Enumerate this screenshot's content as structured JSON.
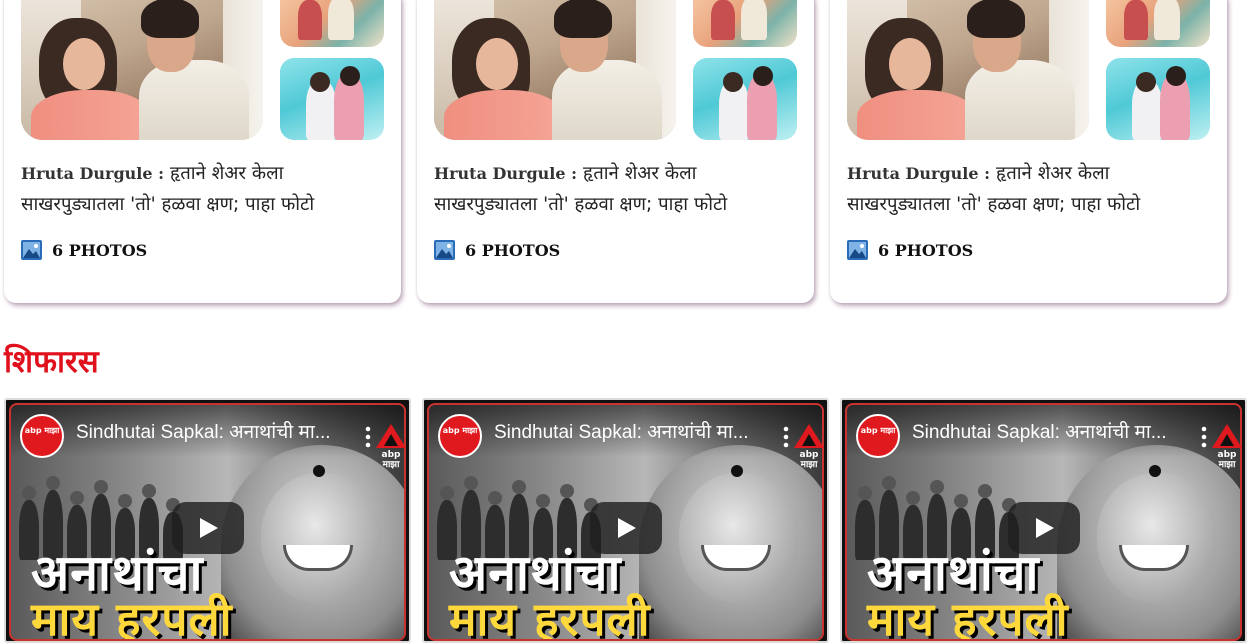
{
  "gallery_cards": [
    {
      "title_name": "Hruta Durgule :",
      "title_rest": "हृताने शेअर केला साखरपुड्यातला 'तो' हळवा क्षण; पाहा फोटो",
      "photos_label": "6 PHOTOS"
    },
    {
      "title_name": "Hruta Durgule :",
      "title_rest": "हृताने शेअर केला साखरपुड्यातला 'तो' हळवा क्षण; पाहा फोटो",
      "photos_label": "6 PHOTOS"
    },
    {
      "title_name": "Hruta Durgule :",
      "title_rest": "हृताने शेअर केला साखरपुड्यातला 'तो' हळवा क्षण; पाहा फोटो",
      "photos_label": "6 PHOTOS"
    }
  ],
  "recommendations": {
    "title": "शिफारस",
    "videos": [
      {
        "channel_logo": "abp माझा",
        "title": "Sindhutai Sapkal: अनाथांची मा...",
        "brand": "abp माझा",
        "overlay_line1": "अनाथांचा",
        "overlay_line2": "माय हरपली"
      },
      {
        "channel_logo": "abp माझा",
        "title": "Sindhutai Sapkal: अनाथांची मा...",
        "brand": "abp माझा",
        "overlay_line1": "अनाथांचा",
        "overlay_line2": "माय हरपली"
      },
      {
        "channel_logo": "abp माझा",
        "title": "Sindhutai Sapkal: अनाथांची मा...",
        "brand": "abp माझा",
        "overlay_line1": "अनाथांचा",
        "overlay_line2": "माय हरपली"
      }
    ]
  },
  "colors": {
    "accent_red": "#e0101d",
    "overlay_yellow": "#ffd93b",
    "photos_icon_blue": "#2b6cb8"
  },
  "icons": {
    "photos": "photos-icon",
    "play": "play-icon",
    "more": "more-vert-icon",
    "brand": "abp-logo-icon"
  }
}
